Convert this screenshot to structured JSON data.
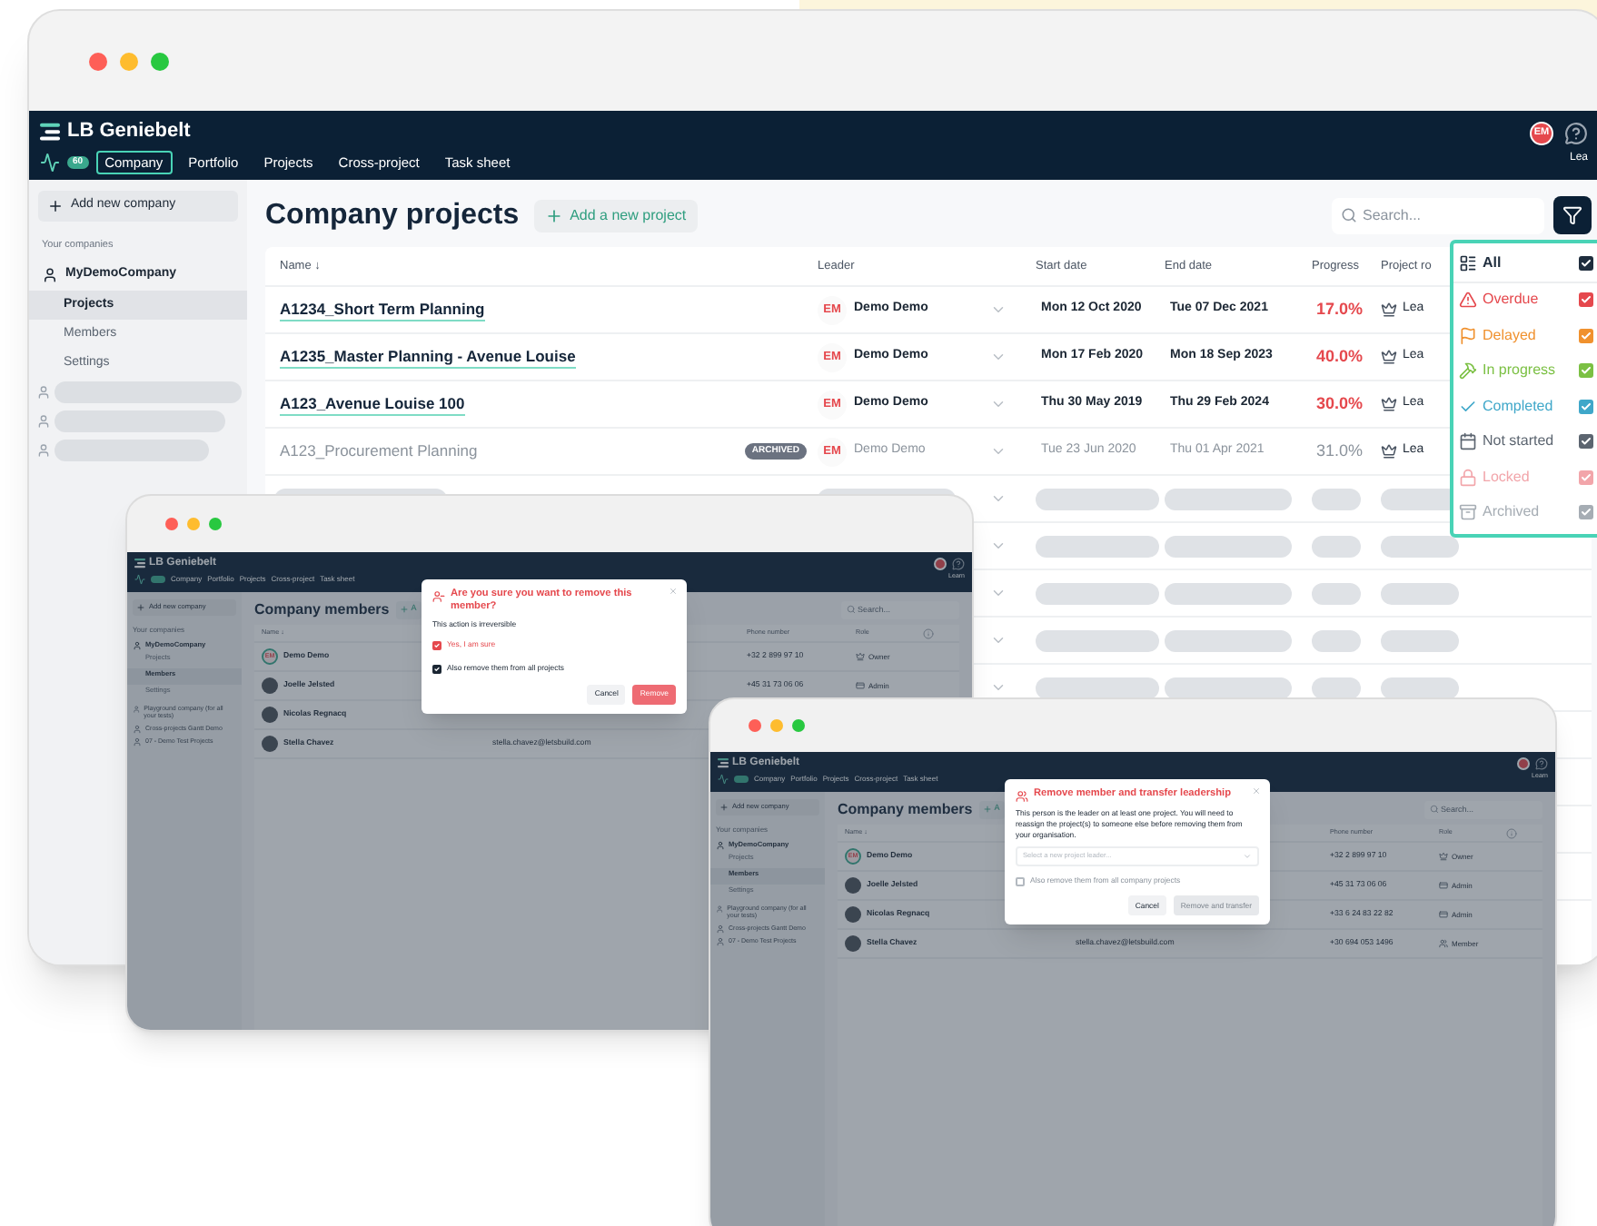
{
  "main_window": {
    "app_name": "LB Geniebelt",
    "notification_count": "60",
    "nav": [
      {
        "label": "Company",
        "selected": true
      },
      {
        "label": "Portfolio",
        "selected": false
      },
      {
        "label": "Projects",
        "selected": false
      },
      {
        "label": "Cross-project",
        "selected": false
      },
      {
        "label": "Task sheet",
        "selected": false
      }
    ],
    "user_initials": "EM",
    "help_label": "Lea",
    "sidebar": {
      "add_button": "Add new company",
      "section_label": "Your companies",
      "company": "MyDemoCompany",
      "items": [
        {
          "label": "Projects",
          "selected": true
        },
        {
          "label": "Members",
          "selected": false
        },
        {
          "label": "Settings",
          "selected": false
        }
      ]
    },
    "title": "Company projects",
    "add_button": "Add a new project",
    "search": {
      "placeholder": "Search..."
    },
    "table": {
      "columns": [
        "Name ↓",
        "Leader",
        "Start date",
        "End date",
        "Progress",
        "Project ro"
      ],
      "rows": [
        {
          "name": "A1234_Short Term Planning",
          "archived": false,
          "leader_initials": "EM",
          "leader": "Demo Demo",
          "start": "Mon 12 Oct 2020",
          "end": "Tue 07 Dec 2021",
          "progress": "17.0%",
          "role": "Lea"
        },
        {
          "name": "A1235_Master Planning - Avenue Louise",
          "archived": false,
          "leader_initials": "EM",
          "leader": "Demo Demo",
          "start": "Mon 17 Feb 2020",
          "end": "Mon 18 Sep 2023",
          "progress": "40.0%",
          "role": "Lea"
        },
        {
          "name": "A123_Avenue Louise 100",
          "archived": false,
          "leader_initials": "EM",
          "leader": "Demo Demo",
          "start": "Thu 30 May 2019",
          "end": "Thu 29 Feb 2024",
          "progress": "30.0%",
          "role": "Lea"
        },
        {
          "name": "A123_Procurement Planning",
          "archived": true,
          "badge": "ARCHIVED",
          "leader_initials": "EM",
          "leader": "Demo Demo",
          "start": "Tue 23 Jun 2020",
          "end": "Thu 01 Apr 2021",
          "progress": "31.0%",
          "role": "Lea"
        }
      ]
    },
    "filter_menu": {
      "items": [
        {
          "kind": "all",
          "label": "All",
          "checked": true,
          "color": "#1f2d3d"
        },
        {
          "kind": "overdue",
          "label": "Overdue",
          "checked": true,
          "color": "#e5484d"
        },
        {
          "kind": "delayed",
          "label": "Delayed",
          "checked": true,
          "color": "#f0912e"
        },
        {
          "kind": "progress",
          "label": "In progress",
          "checked": true,
          "color": "#7bc043"
        },
        {
          "kind": "completed",
          "label": "Completed",
          "checked": true,
          "color": "#3fa7c9"
        },
        {
          "kind": "notstarted",
          "label": "Not started",
          "checked": true,
          "color": "#5c6570"
        },
        {
          "kind": "locked",
          "label": "Locked",
          "checked": true,
          "color": "#f2a5aa"
        },
        {
          "kind": "archived",
          "label": "Archived",
          "checked": true,
          "color": "#a6adb4"
        }
      ]
    }
  },
  "member_windows": [
    {
      "app_name": "LB Geniebelt",
      "nav": [
        "Company",
        "Portfolio",
        "Projects",
        "Cross-project",
        "Task sheet"
      ],
      "help_label": "Learn",
      "sidebar": {
        "add_button": "Add new company",
        "section_label": "Your companies",
        "company": "MyDemoCompany",
        "items": [
          {
            "label": "Projects",
            "selected": false
          },
          {
            "label": "Members",
            "selected": true
          },
          {
            "label": "Settings",
            "selected": false
          }
        ],
        "other_companies": [
          "Playground company (for all your tests)",
          "Cross-projects Gantt Demo",
          "07 - Demo Test Projects"
        ]
      },
      "title": "Company members",
      "add_button": "A",
      "search": {
        "placeholder": "Search..."
      },
      "columns": [
        "Name ↓",
        "Phone number",
        "Role"
      ],
      "members": [
        {
          "name": "Demo Demo",
          "initials": "EM",
          "phone": "+32 2 899 97 10",
          "role": "Owner",
          "kind": "owner"
        },
        {
          "name": "Joelle Jelsted",
          "phone": "+45 31 73 06 06",
          "role": "Admin",
          "kind": "admin"
        },
        {
          "name": "Nicolas Regnacq"
        },
        {
          "name": "Stella Chavez",
          "email": "stella.chavez@letsbuild.com"
        }
      ],
      "dialog": {
        "kind": "confirm",
        "title": "Are you sure you want to remove this member?",
        "message": "This action is irreversible",
        "checks": [
          {
            "label": "Yes, I am sure",
            "checked": true,
            "kind": "danger"
          },
          {
            "label": "Also remove them from all projects",
            "checked": true,
            "kind": "plain"
          }
        ],
        "cancel": "Cancel",
        "confirm": "Remove",
        "confirm_disabled": false
      }
    },
    {
      "app_name": "LB Geniebelt",
      "nav": [
        "Company",
        "Portfolio",
        "Projects",
        "Cross-project",
        "Task sheet"
      ],
      "help_label": "Learn",
      "sidebar": {
        "add_button": "Add new company",
        "section_label": "Your companies",
        "company": "MyDemoCompany",
        "items": [
          {
            "label": "Projects",
            "selected": false
          },
          {
            "label": "Members",
            "selected": true
          },
          {
            "label": "Settings",
            "selected": false
          }
        ],
        "other_companies": [
          "Playground company (for all your tests)",
          "Cross-projects Gantt Demo",
          "07 - Demo Test Projects"
        ]
      },
      "title": "Company members",
      "add_button": "A",
      "search": {
        "placeholder": "Search..."
      },
      "columns": [
        "Name ↓",
        "Phone number",
        "Role"
      ],
      "members": [
        {
          "name": "Demo Demo",
          "initials": "EM",
          "phone": "+32 2 899 97 10",
          "role": "Owner",
          "kind": "owner"
        },
        {
          "name": "Joelle Jelsted",
          "phone": "+45 31 73 06 06",
          "role": "Admin",
          "kind": "admin"
        },
        {
          "name": "Nicolas Regnacq",
          "phone": "+33 6 24 83 22 82",
          "role": "Admin",
          "kind": "admin"
        },
        {
          "name": "Stella Chavez",
          "email": "stella.chavez@letsbuild.com",
          "phone": "+30 694 053 1496",
          "role": "Member",
          "kind": "member"
        }
      ],
      "dialog": {
        "kind": "transfer",
        "title": "Remove member and transfer leadership",
        "message": "This person is the leader on at least one project. You will need to reassign the project(s) to someone else before removing them from your organisation.",
        "select_placeholder": "Select a new project leader...",
        "checks": [
          {
            "label": "Also remove them from all company projects",
            "checked": false,
            "kind": "plain"
          }
        ],
        "cancel": "Cancel",
        "confirm": "Remove and transfer",
        "confirm_disabled": true
      }
    }
  ]
}
